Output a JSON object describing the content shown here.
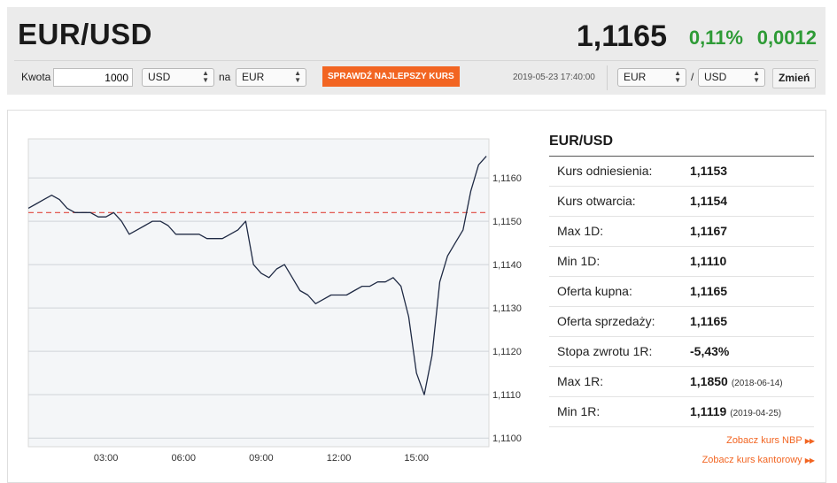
{
  "header": {
    "pair": "EUR/USD",
    "price": "1,1165",
    "change_pct": "0,11%",
    "change_abs": "0,0012"
  },
  "converter": {
    "amount_label": "Kwota",
    "amount_value": "1000",
    "from_currency": "USD",
    "na_label": "na",
    "to_currency": "EUR",
    "best_rate_button": "SPRAWDŹ NAJLEPSZY KURS",
    "timestamp": "2019-05-23 17:40:00",
    "pair_base": "EUR",
    "pair_separator": "/",
    "pair_quote": "USD",
    "change_button": "Zmień"
  },
  "chart_data": {
    "type": "line",
    "title": "",
    "xlabel": "",
    "ylabel": "",
    "x_ticks": [
      "03:00",
      "06:00",
      "09:00",
      "12:00",
      "15:00"
    ],
    "y_ticks": [
      "1,1160",
      "1,1150",
      "1,1140",
      "1,1130",
      "1,1120",
      "1,1110",
      "1,1100"
    ],
    "ylim": [
      1.1098,
      1.1169
    ],
    "xlim": [
      0,
      17.8
    ],
    "reference_line": 1.1152,
    "grid": "horizontal",
    "series": [
      {
        "x": [
          0.0,
          0.3,
          0.6,
          0.9,
          1.2,
          1.5,
          1.8,
          2.1,
          2.4,
          2.7,
          3.0,
          3.3,
          3.6,
          3.9,
          4.2,
          4.5,
          4.8,
          5.1,
          5.4,
          5.7,
          6.0,
          6.3,
          6.6,
          6.9,
          7.2,
          7.5,
          7.8,
          8.1,
          8.4,
          8.7,
          9.0,
          9.3,
          9.6,
          9.9,
          10.2,
          10.5,
          10.8,
          11.1,
          11.4,
          11.7,
          12.0,
          12.3,
          12.6,
          12.9,
          13.2,
          13.5,
          13.8,
          14.1,
          14.4,
          14.7,
          15.0,
          15.3,
          15.6,
          15.9,
          16.2,
          16.5,
          16.8,
          17.1,
          17.4,
          17.7
        ],
        "y": [
          1.1153,
          1.1154,
          1.1155,
          1.1156,
          1.1155,
          1.1153,
          1.1152,
          1.1152,
          1.1152,
          1.1151,
          1.1151,
          1.1152,
          1.115,
          1.1147,
          1.1148,
          1.1149,
          1.115,
          1.115,
          1.1149,
          1.1147,
          1.1147,
          1.1147,
          1.1147,
          1.1146,
          1.1146,
          1.1146,
          1.1147,
          1.1148,
          1.115,
          1.114,
          1.1138,
          1.1137,
          1.1139,
          1.114,
          1.1137,
          1.1134,
          1.1133,
          1.1131,
          1.1132,
          1.1133,
          1.1133,
          1.1133,
          1.1134,
          1.1135,
          1.1135,
          1.1136,
          1.1136,
          1.1137,
          1.1135,
          1.1128,
          1.1115,
          1.111,
          1.1119,
          1.1136,
          1.1142,
          1.1145,
          1.1148,
          1.1157,
          1.1163,
          1.1165
        ]
      }
    ]
  },
  "stats": {
    "title": "EUR/USD",
    "rows": [
      {
        "label": "Kurs odniesienia:",
        "value": "1,1153",
        "date": ""
      },
      {
        "label": "Kurs otwarcia:",
        "value": "1,1154",
        "date": ""
      },
      {
        "label": "Max 1D:",
        "value": "1,1167",
        "date": ""
      },
      {
        "label": "Min 1D:",
        "value": "1,1110",
        "date": ""
      },
      {
        "label": "Oferta kupna:",
        "value": "1,1165",
        "date": ""
      },
      {
        "label": "Oferta sprzedaży:",
        "value": "1,1165",
        "date": ""
      },
      {
        "label": "Stopa zwrotu 1R:",
        "value": "-5,43%",
        "date": ""
      },
      {
        "label": "Max 1R:",
        "value": "1,1850",
        "date": "(2018-06-14)"
      },
      {
        "label": "Min 1R:",
        "value": "1,1119",
        "date": "(2019-04-25)"
      }
    ],
    "link_nbp": "Zobacz kurs NBP",
    "link_kantor": "Zobacz kurs kantorowy"
  },
  "colors": {
    "accent_orange": "#f26522",
    "positive_green": "#2e9b36",
    "line_navy": "#1f2a44",
    "reference_red": "#e0463c"
  }
}
